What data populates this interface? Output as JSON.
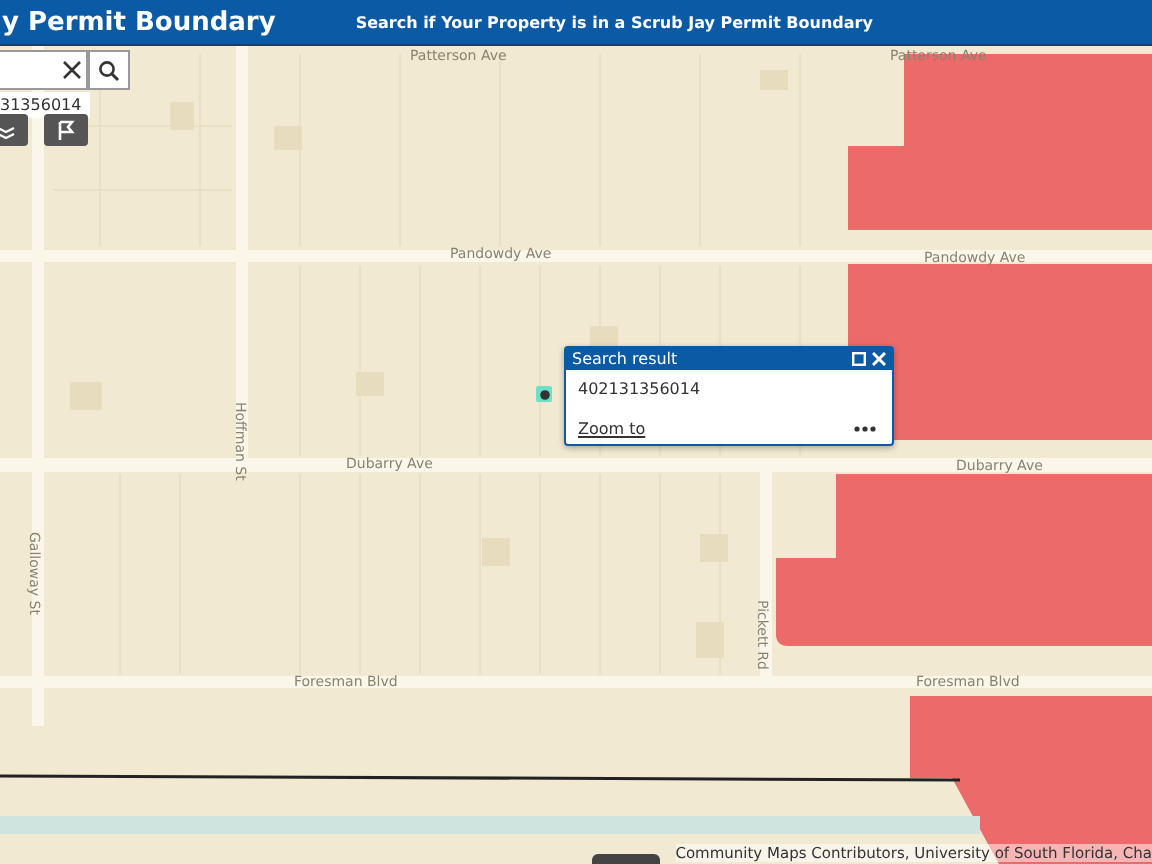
{
  "header": {
    "title": "y Permit Boundary",
    "subtitle": "Search if Your Property is in a Scrub Jay Permit Boundary"
  },
  "search": {
    "suggestion": "31356014"
  },
  "street_labels": [
    {
      "label": "Patterson Ave",
      "kind": "horizontal"
    },
    {
      "label": "Patterson Ave",
      "kind": "horizontal"
    },
    {
      "label": "Pandowdy Ave",
      "kind": "horizontal"
    },
    {
      "label": "Pandowdy Ave",
      "kind": "horizontal"
    },
    {
      "label": "Hoffman St",
      "kind": "vertical"
    },
    {
      "label": "Dubarry Ave",
      "kind": "horizontal"
    },
    {
      "label": "Dubarry Ave",
      "kind": "horizontal"
    },
    {
      "label": "Galloway St",
      "kind": "vertical"
    },
    {
      "label": "Pickett Rd",
      "kind": "vertical"
    },
    {
      "label": "Foresman Blvd",
      "kind": "horizontal"
    },
    {
      "label": "Foresman Blvd",
      "kind": "horizontal"
    }
  ],
  "popup": {
    "title": "Search result",
    "value": "402131356014",
    "link": "Zoom to"
  },
  "attribution": "Community Maps Contributors, University of South Florida, Cha"
}
